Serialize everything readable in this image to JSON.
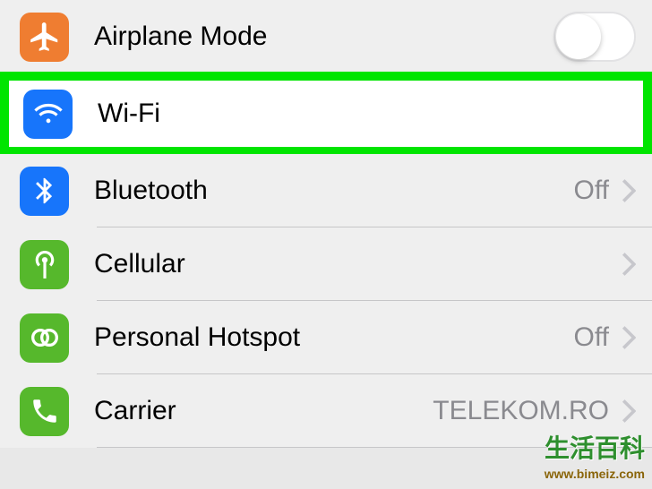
{
  "rows": {
    "airplane": {
      "label": "Airplane Mode",
      "toggle": false
    },
    "wifi": {
      "label": "Wi-Fi"
    },
    "bluetooth": {
      "label": "Bluetooth",
      "value": "Off"
    },
    "cellular": {
      "label": "Cellular"
    },
    "hotspot": {
      "label": "Personal Hotspot",
      "value": "Off"
    },
    "carrier": {
      "label": "Carrier",
      "value": "TELEKOM.RO"
    }
  },
  "watermark": {
    "title": "生活百科",
    "url": "www.bimeiz.com"
  },
  "colors": {
    "highlight": "#00e500",
    "orange": "#ef7d31",
    "blue": "#1775fb",
    "green": "#56b82c"
  }
}
